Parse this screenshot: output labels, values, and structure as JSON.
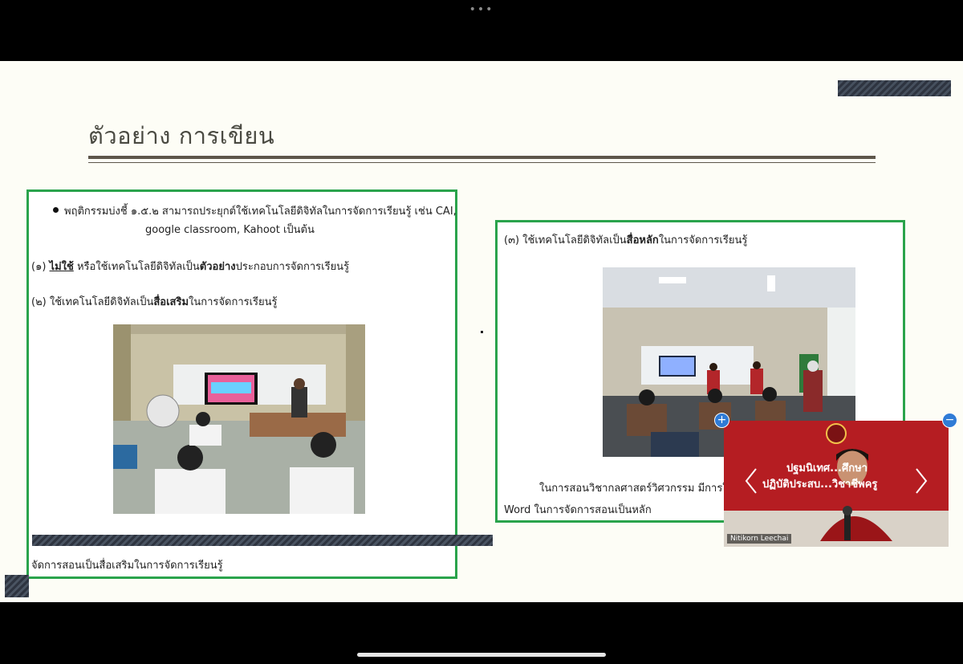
{
  "window": {
    "more_dots": "•••"
  },
  "slide": {
    "title": "ตัวอย่าง การเขียน",
    "left_box": {
      "bullet": "พฤติกรรมบ่งชี้ ๑.๕.๒ สามารถประยุกต์ใช้เทคโนโลยีดิจิทัลในการจัดการเรียนรู้ เช่น CAI,",
      "bullet_line2": "google classroom, Kahoot เป็นต้น",
      "item1_prefix": "(๑) ",
      "item1_em": "ไม่ใช้",
      "item1_mid": " หรือใช้เทคโนโลยีดิจิทัลเป็น",
      "item1_bold": "ตัวอย่าง",
      "item1_suffix": "ประกอบการจัดการเรียนรู้",
      "item2_prefix": "(๒) ใช้เทคโนโลยีดิจิทัลเป็น",
      "item2_bold": "สื่อเสริม",
      "item2_suffix": "ในการจัดการเรียนรู้",
      "caption": "จัดการสอนเป็นสื่อเสริมในการจัดการเรียนรู้"
    },
    "right_box": {
      "item3_prefix": "(๓) ใช้เทคโนโลยีดิจิทัลเป็น",
      "item3_bold": "สื่อหลัก",
      "item3_suffix": "ในการจัดการเรียนรู้",
      "caption_line1": "ในการสอนวิชากลศาสตร์วิศวกรรม มีการใช้",
      "caption_line2": "Word ในการจัดการสอนเป็นหลัก"
    }
  },
  "video_tile": {
    "participant_name": "Nitikorn Leechai",
    "banner_line1": "ปฐมนิเทศ...ศึกษา",
    "banner_line2": "ปฏิบัติประสบ...วิชาชีพครู",
    "expand_label": "+",
    "minimize_label": "−"
  }
}
